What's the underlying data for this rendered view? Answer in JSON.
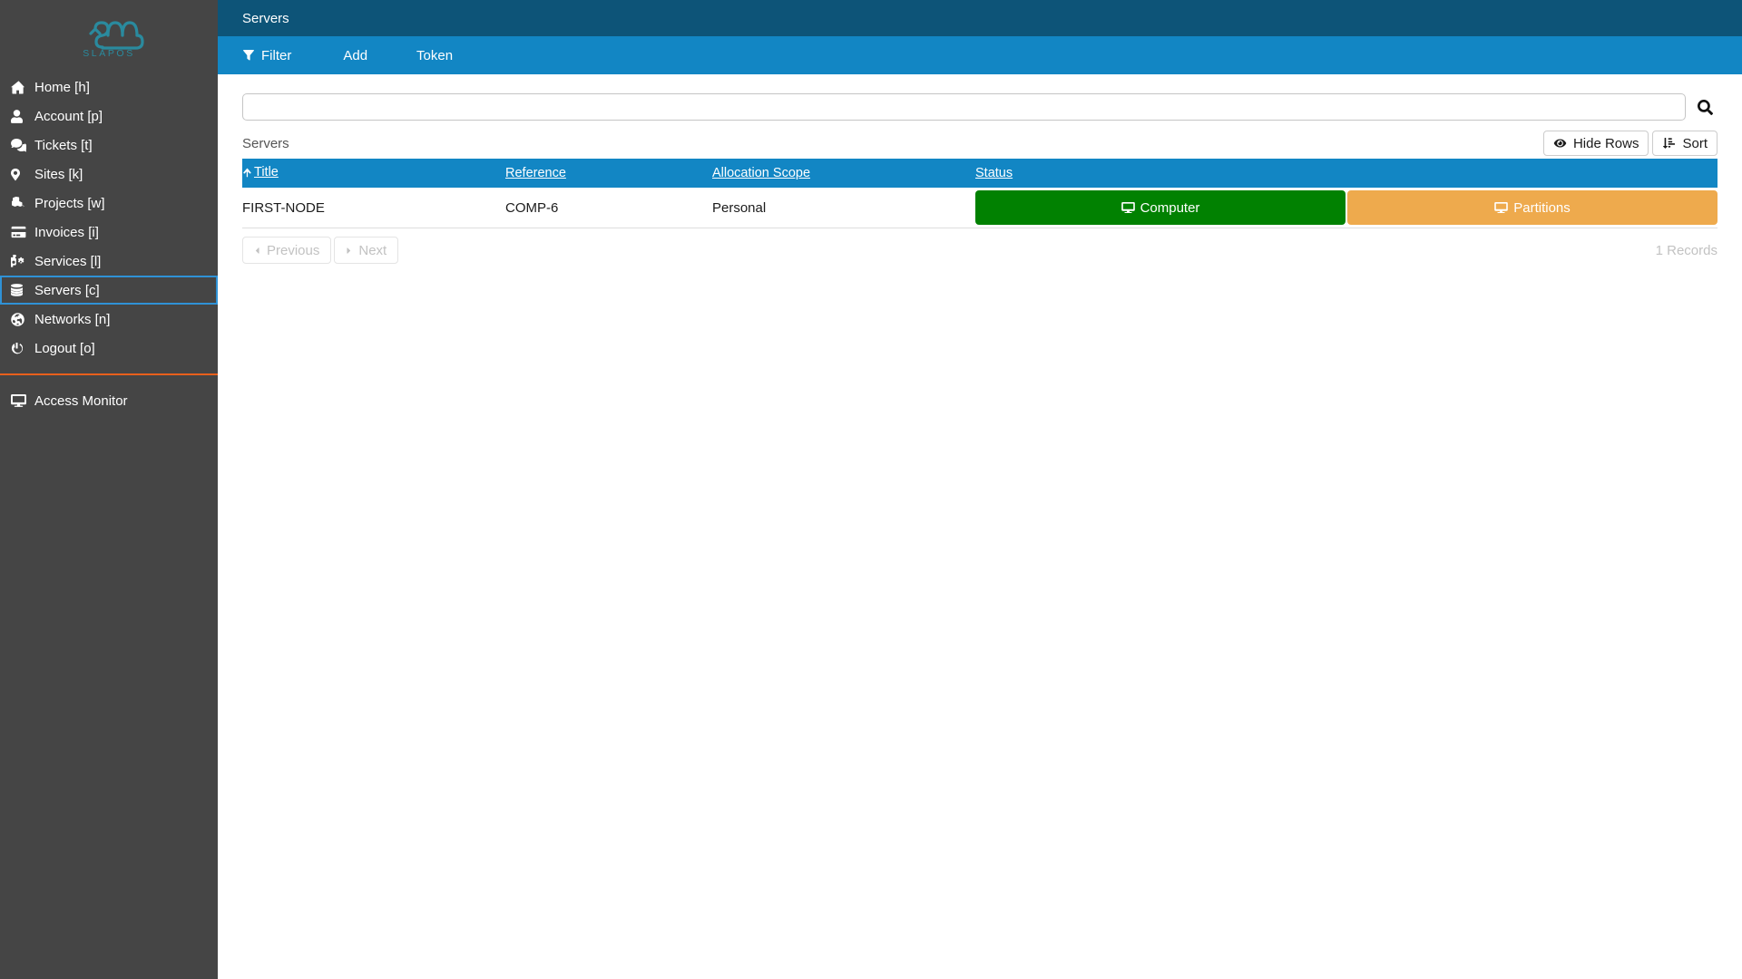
{
  "brand": {
    "logo_text": "SLAPOS",
    "logo_color": "#2a8a9e"
  },
  "sidebar": {
    "items": [
      {
        "label": "Home [h]",
        "icon": "home-icon",
        "name": "sidebar-item-home"
      },
      {
        "label": "Account [p]",
        "icon": "user-icon",
        "name": "sidebar-item-account"
      },
      {
        "label": "Tickets [t]",
        "icon": "comments-icon",
        "name": "sidebar-item-tickets"
      },
      {
        "label": "Sites [k]",
        "icon": "map-marker-icon",
        "name": "sidebar-item-sites"
      },
      {
        "label": "Projects [w]",
        "icon": "cubes-icon",
        "name": "sidebar-item-projects"
      },
      {
        "label": "Invoices [i]",
        "icon": "credit-card-icon",
        "name": "sidebar-item-invoices"
      },
      {
        "label": "Services [l]",
        "icon": "cogs-icon",
        "name": "sidebar-item-services"
      },
      {
        "label": "Servers [c]",
        "icon": "database-icon",
        "name": "sidebar-item-servers",
        "focused": true
      },
      {
        "label": "Networks [n]",
        "icon": "globe-icon",
        "name": "sidebar-item-networks"
      },
      {
        "label": "Logout [o]",
        "icon": "power-off-icon",
        "name": "sidebar-item-logout"
      }
    ],
    "bottom_items": [
      {
        "label": "Access Monitor",
        "icon": "desktop-icon",
        "name": "sidebar-item-access-monitor"
      }
    ],
    "background_color": "#454545",
    "divider_color": "#e8601c",
    "focus_outline_color": "#2f92d6"
  },
  "header": {
    "title": "Servers",
    "background_color": "#0d5478"
  },
  "toolbar": {
    "background_color": "#1286c4",
    "filter_label": "Filter",
    "add_label": "Add",
    "token_label": "Token"
  },
  "search": {
    "value": "",
    "placeholder": "",
    "icon": "search-icon"
  },
  "listbox": {
    "title": "Servers",
    "hide_rows_label": "Hide Rows",
    "sort_label": "Sort",
    "header_background_color": "#1286c4",
    "columns": [
      {
        "label": "Title",
        "sorted": true,
        "sort_dir": "asc",
        "name": "column-header-title"
      },
      {
        "label": "Reference",
        "sorted": false,
        "name": "column-header-reference"
      },
      {
        "label": "Allocation Scope",
        "sorted": false,
        "name": "column-header-allocation-scope"
      },
      {
        "label": "Status",
        "sorted": false,
        "name": "column-header-status"
      }
    ],
    "rows": [
      {
        "title": "FIRST-NODE",
        "reference": "COMP-6",
        "allocation_scope": "Personal",
        "status_buttons": [
          {
            "label": "Computer",
            "color": "#018101",
            "icon": "desktop-icon"
          },
          {
            "label": "Partitions",
            "color": "#eeaa4d",
            "icon": "desktop-icon"
          }
        ]
      }
    ]
  },
  "pagination": {
    "previous_label": "Previous",
    "next_label": "Next",
    "records_label": "1 Records",
    "previous_disabled": true,
    "next_disabled": true
  }
}
